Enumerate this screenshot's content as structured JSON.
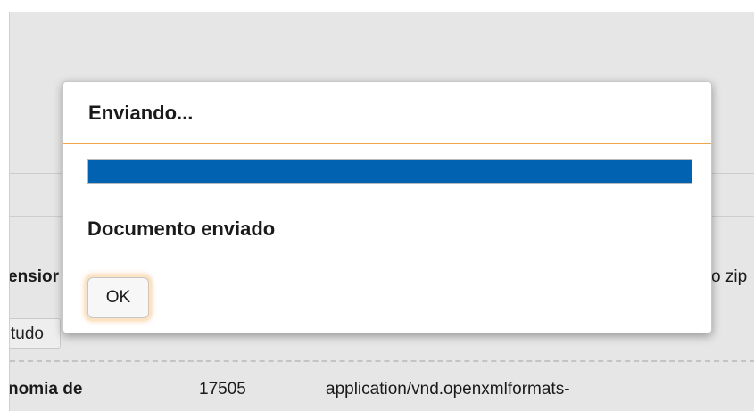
{
  "background": {
    "row_header_left": "ensior",
    "row_header_right": "o zip",
    "select_all_label": "tudo",
    "row": {
      "name": "nomia de",
      "size": "17505",
      "type": "application/vnd.openxmlformats-"
    }
  },
  "dialog": {
    "title": "Enviando...",
    "progress_percent": 100,
    "message": "Documento enviado",
    "ok_label": "OK"
  },
  "colors": {
    "progress_fill": "#0062b1",
    "accent_separator": "#f0a64b",
    "page_background": "#e6e6e6"
  }
}
